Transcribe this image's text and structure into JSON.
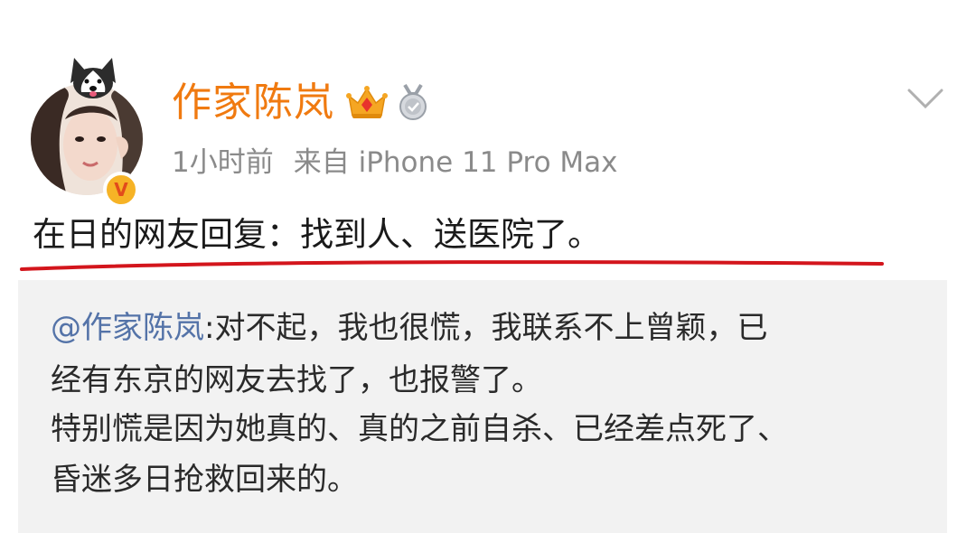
{
  "post": {
    "username": "作家陈岚",
    "time": "1小时前",
    "source": "来自 iPhone 11 Pro Max",
    "text": "在日的网友回复：找到人、送医院了。"
  },
  "reply": {
    "mention": "@作家陈岚",
    "lines": [
      ":对不起，我也很慌，我联系不上曾颖，已",
      "经有东京的网友去找了，也报警了。",
      "特别慌是因为她真的、真的之前自杀、已经差点死了、",
      "昏迷多日抢救回来的。"
    ]
  },
  "badges": {
    "verified": "V",
    "crown_icon": "crown-icon",
    "medal_icon": "medal-icon"
  },
  "colors": {
    "username": "#f07a10",
    "mention": "#5473a8",
    "underline": "#d3151c",
    "reply_bg": "#f2f2f2",
    "meta": "#8a8a8a"
  }
}
